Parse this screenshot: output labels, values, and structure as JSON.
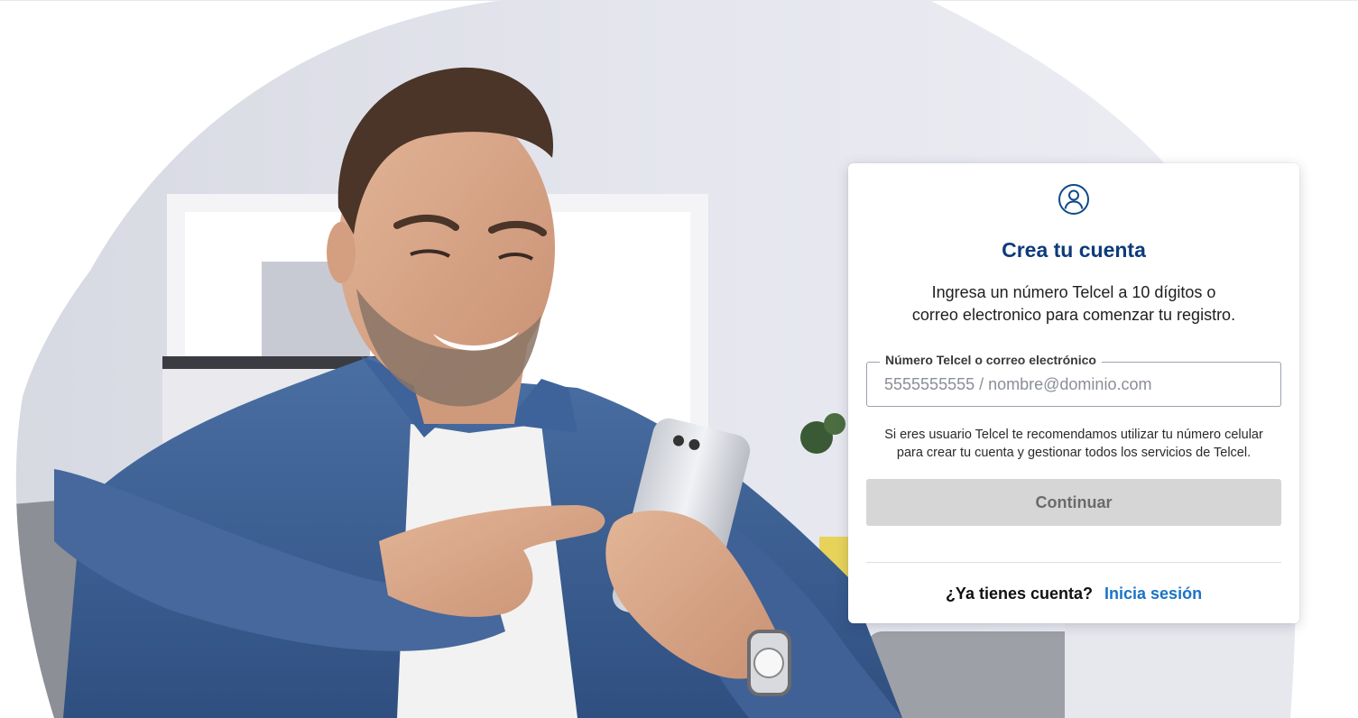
{
  "card": {
    "icon": "user-circle-icon",
    "title": "Crea tu cuenta",
    "description_line1": "Ingresa un número Telcel a 10 dígitos o",
    "description_line2": "correo electronico para comenzar tu registro.",
    "field_label": "Número Telcel o correo electrónico",
    "field_placeholder": "5555555555 / nombre@dominio.com",
    "field_value": "",
    "hint_line1": "Si eres usuario Telcel te recomendamos utilizar tu número celular",
    "hint_line2": "para crear tu cuenta y gestionar todos los servicios de Telcel.",
    "continue_label": "Continuar",
    "continue_disabled": true,
    "have_account_label": "¿Ya tienes cuenta?",
    "signin_label": "Inicia sesión"
  },
  "colors": {
    "title": "#0d3b7a",
    "link": "#1a73c8",
    "button_disabled_bg": "#d6d6d6",
    "icon": "#0d4a8a"
  }
}
